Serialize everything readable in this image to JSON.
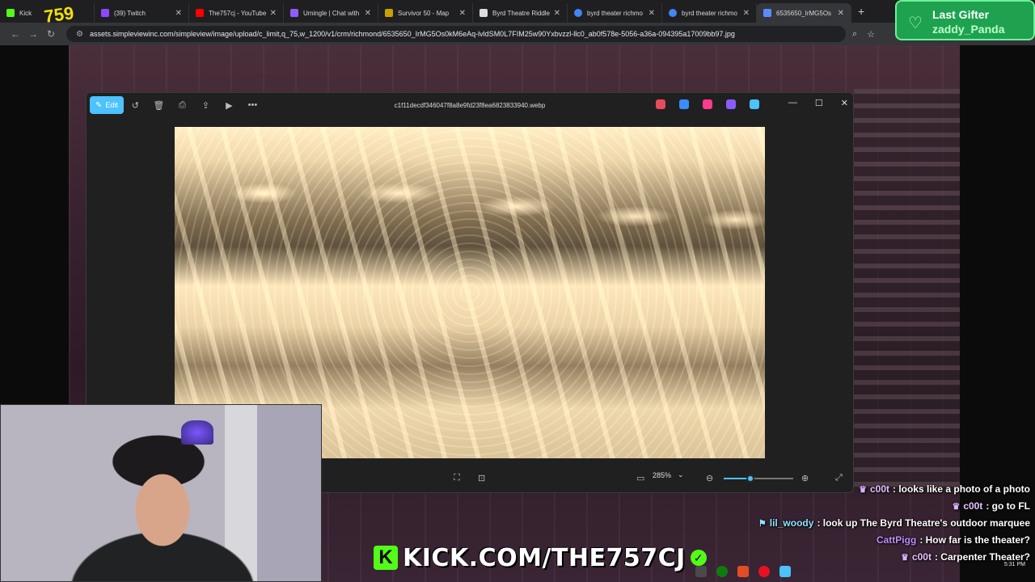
{
  "browser": {
    "tabs": [
      {
        "title": "Kick",
        "color": "#53fc18"
      },
      {
        "title": "(39) Twitch",
        "color": "#9146ff"
      },
      {
        "title": "The757cj - YouTube",
        "color": "#ff0000"
      },
      {
        "title": "Umingle | Chat with",
        "color": "#8e5cff"
      },
      {
        "title": "Survivor 50 - Map",
        "color": "#c8a000"
      },
      {
        "title": "Byrd Theatre Riddle",
        "color": "#dddddd"
      },
      {
        "title": "byrd theater richmo",
        "color": "#4285f4"
      },
      {
        "title": "byrd theater richmo",
        "color": "#4285f4"
      },
      {
        "title": "6535650_IrMG5Os",
        "color": "#5b8cff"
      }
    ],
    "url": "assets.simpleviewinc.com/simpleview/image/upload/c_limit,q_75,w_1200/v1/crm/richmond/6535650_IrMG5Os0kM6eAq-lvldSM0L7FIM25w90Yxbvzzl-llc0_ab0f578e-5056-a36a-094395a17009bb97.jpg"
  },
  "photos": {
    "edit_label": "Edit",
    "filename": "c1f11decdf346047f8a8e9fd23f8ea6823833940.webp",
    "zoom": "285%",
    "zoom_level": 0.38,
    "app_icons": [
      "#e84a5f",
      "#3b8cff",
      "#ff3b8c",
      "#8a5cff",
      "#4cc2ff"
    ]
  },
  "overlay": {
    "last_gifter_label": "Last Gifter",
    "last_gifter_name": "zaddy_Panda",
    "kick_url": "KICK.COM/THE757CJ"
  },
  "chat": [
    {
      "user": "c00t",
      "user_color": "#e7c3ff",
      "text": ": looks like a photo of a photo"
    },
    {
      "user": "c00t",
      "user_color": "#e7c3ff",
      "text": ": go to FL"
    },
    {
      "user": "lil_woody",
      "user_color": "#8fe3ff",
      "text": ": look up The Byrd Theatre's outdoor marquee"
    },
    {
      "user": "CattPigg",
      "user_color": "#c28cff",
      "text": ": How far is the theater?"
    },
    {
      "user": "c00t",
      "user_color": "#e7c3ff",
      "text": ": Carpenter Theater?"
    }
  ],
  "clock": {
    "time": "5:31 PM"
  }
}
